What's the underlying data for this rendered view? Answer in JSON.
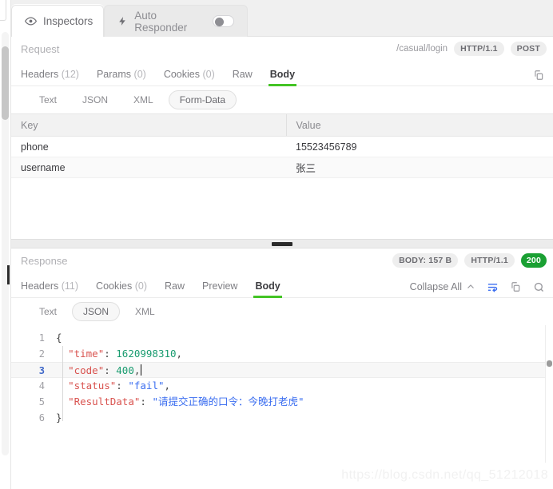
{
  "top_tabs": [
    {
      "label": "Inspectors",
      "icon": "eye-icon",
      "active": true
    },
    {
      "label": "Auto Responder",
      "icon": "bolt-icon",
      "active": false,
      "toggle": "off"
    }
  ],
  "request": {
    "title": "Request",
    "url": "/casual/login",
    "protocol_badge": "HTTP/1.1",
    "method_badge": "POST",
    "copy_icon": "copy-icon",
    "tabs": [
      {
        "label": "Headers",
        "count": "(12)",
        "active": false
      },
      {
        "label": "Params",
        "count": "(0)",
        "active": false
      },
      {
        "label": "Cookies",
        "count": "(0)",
        "active": false
      },
      {
        "label": "Raw",
        "count": "",
        "active": false
      },
      {
        "label": "Body",
        "count": "",
        "active": true
      }
    ],
    "formats": [
      {
        "label": "Text",
        "active": false
      },
      {
        "label": "JSON",
        "active": false
      },
      {
        "label": "XML",
        "active": false
      },
      {
        "label": "Form-Data",
        "active": true
      }
    ],
    "table": {
      "columns": [
        "Key",
        "Value"
      ],
      "rows": [
        [
          "phone",
          "15523456789"
        ],
        [
          "username",
          "张三"
        ]
      ]
    }
  },
  "response": {
    "title": "Response",
    "size_badge": "BODY: 157 B",
    "protocol_badge": "HTTP/1.1",
    "status_badge": "200",
    "tabs": [
      {
        "label": "Headers",
        "count": "(11)",
        "active": false
      },
      {
        "label": "Cookies",
        "count": "(0)",
        "active": false
      },
      {
        "label": "Raw",
        "count": "",
        "active": false
      },
      {
        "label": "Preview",
        "count": "",
        "active": false
      },
      {
        "label": "Body",
        "count": "",
        "active": true
      }
    ],
    "collapse_all": "Collapse All",
    "toolbar_icons": [
      "chevron-up-icon",
      "wrap-text-icon",
      "copy-icon",
      "search-icon"
    ],
    "formats": [
      {
        "label": "Text",
        "active": false
      },
      {
        "label": "JSON",
        "active": true
      },
      {
        "label": "XML",
        "active": false
      }
    ],
    "json_lines": [
      {
        "num": "1",
        "active": false
      },
      {
        "num": "2",
        "active": false
      },
      {
        "num": "3",
        "active": true
      },
      {
        "num": "4",
        "active": false
      },
      {
        "num": "5",
        "active": false
      },
      {
        "num": "6",
        "active": false
      }
    ],
    "json_body": {
      "time": "1620998310",
      "code": "400",
      "status": "fail",
      "ResultData": "请提交正确的口令：今晚打老虎"
    },
    "json_tokens": {
      "open_brace": "{",
      "close_brace": "}",
      "k_time": "\"time\"",
      "v_time": "1620998310",
      "k_code": "\"code\"",
      "v_code": "400",
      "k_status": "\"status\"",
      "v_status": "\"fail\"",
      "k_result": "\"ResultData\"",
      "v_result": "\"请提交正确的口令：今晚打老虎\"",
      "colon": ": ",
      "comma": ","
    }
  },
  "watermark": "https://blog.csdn.net/qq_51212018",
  "colors": {
    "accent_green": "#44c425",
    "status_green": "#1aa033",
    "json_key": "#d9534f",
    "json_string": "#3b6ef0",
    "json_number": "#1a9c70",
    "active_line_number": "#4169c9"
  }
}
